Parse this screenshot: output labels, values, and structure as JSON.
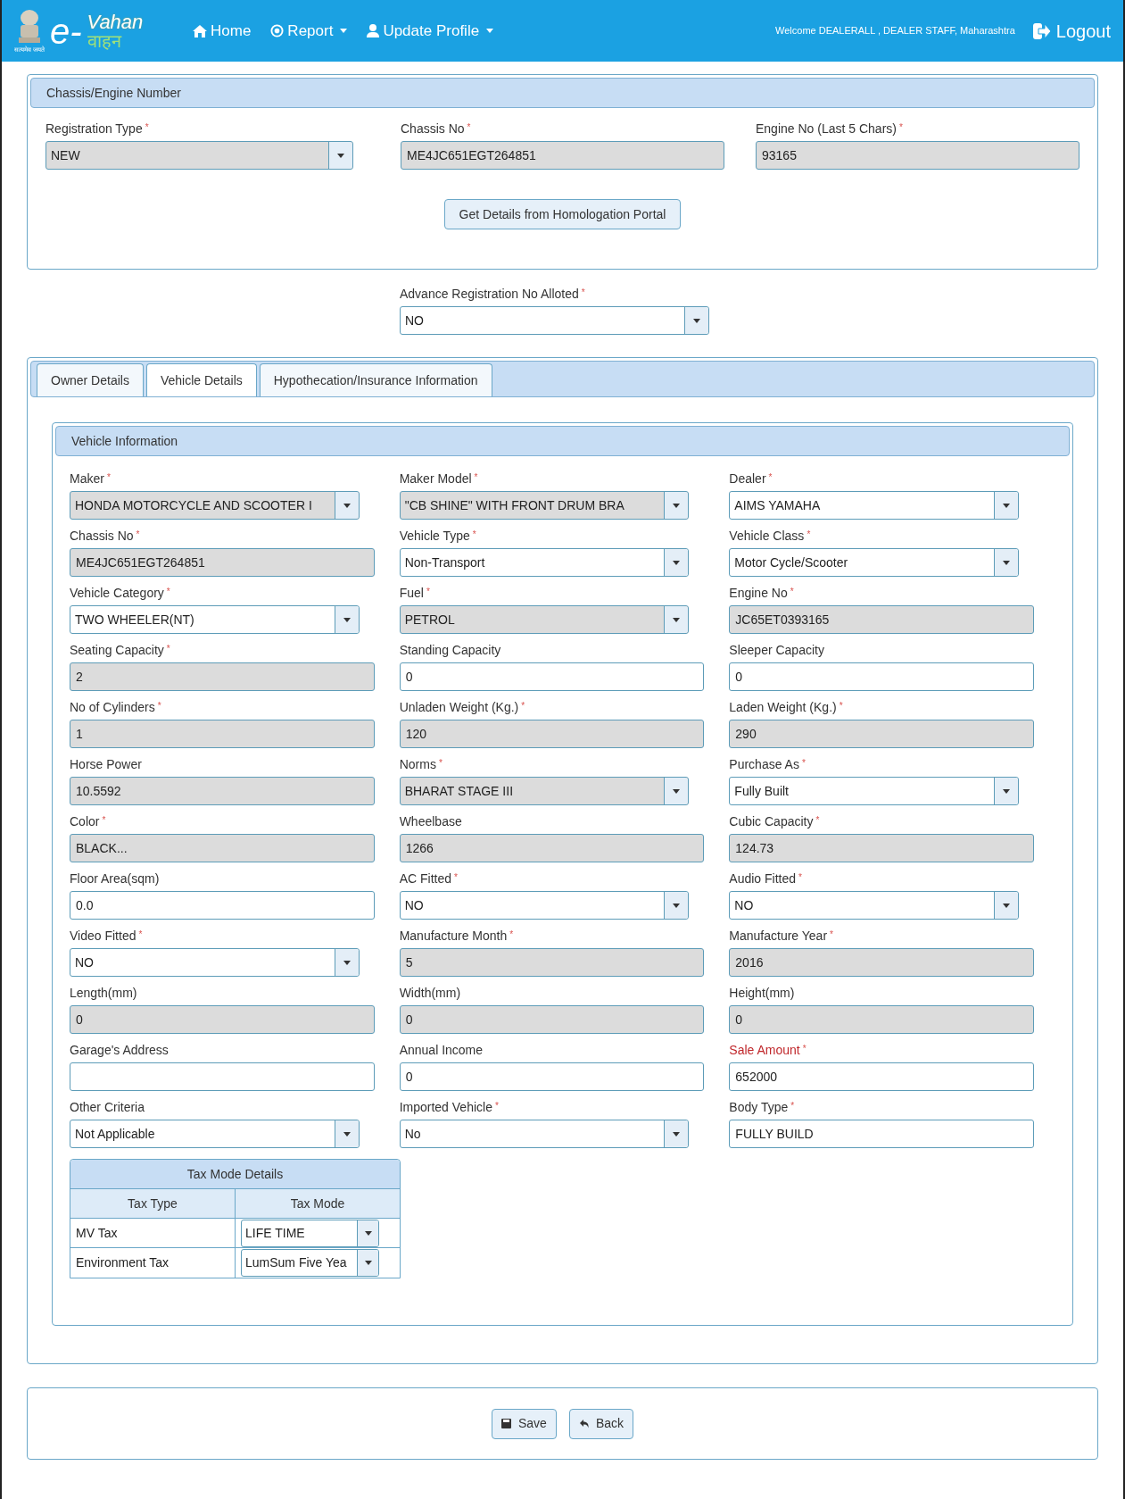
{
  "header": {
    "logo": {
      "prefix": "e-",
      "name": "Vahan",
      "name_hi": "वाहन",
      "motto": "सत्यमेव जयते"
    },
    "nav": [
      {
        "label": "Home",
        "dropdown": false
      },
      {
        "label": "Report",
        "dropdown": true
      },
      {
        "label": "Update Profile",
        "dropdown": true
      }
    ],
    "welcome": "Welcome DEALERALL , DEALER STAFF, Maharashtra",
    "logout": "Logout"
  },
  "chassis_panel": {
    "title": "Chassis/Engine Number",
    "fields": [
      {
        "label": "Registration Type",
        "marker": "*",
        "kind": "select",
        "disabled": true,
        "value": "NEW"
      },
      {
        "label": "Chassis No",
        "marker": "*",
        "kind": "text",
        "disabled": true,
        "value": "ME4JC651EGT264851"
      },
      {
        "label": "Engine No (Last 5 Chars)",
        "marker": "*",
        "kind": "text",
        "disabled": true,
        "value": "93165"
      }
    ],
    "button": "Get Details from Homologation Portal"
  },
  "advance": {
    "label": "Advance Registration No Alloted",
    "marker": "*",
    "kind": "select",
    "disabled": false,
    "value": "NO"
  },
  "tabs": [
    {
      "label": "Owner Details",
      "selected": false
    },
    {
      "label": "Vehicle Details",
      "selected": true
    },
    {
      "label": "Hypothecation/Insurance Information",
      "selected": false
    }
  ],
  "vehicle_info": {
    "title": "Vehicle Information",
    "fields": [
      {
        "label": "Maker",
        "marker": "*",
        "alert": false,
        "kind": "select",
        "disabled": true,
        "value": "HONDA MOTORCYCLE AND SCOOTER I"
      },
      {
        "label": "Maker Model",
        "marker": "*",
        "alert": false,
        "kind": "select",
        "disabled": true,
        "value": "\"CB SHINE\" WITH FRONT DRUM BRA"
      },
      {
        "label": "Dealer",
        "marker": "*",
        "alert": false,
        "kind": "select",
        "disabled": false,
        "value": "AIMS YAMAHA"
      },
      {
        "label": "Chassis No",
        "marker": "*",
        "alert": false,
        "kind": "text",
        "disabled": true,
        "value": "ME4JC651EGT264851"
      },
      {
        "label": "Vehicle Type",
        "marker": "*",
        "alert": false,
        "kind": "select",
        "disabled": false,
        "value": "Non-Transport"
      },
      {
        "label": "Vehicle Class",
        "marker": "*",
        "alert": false,
        "kind": "select",
        "disabled": false,
        "value": "Motor Cycle/Scooter"
      },
      {
        "label": "Vehicle Category",
        "marker": "*",
        "alert": false,
        "kind": "select",
        "disabled": false,
        "value": "TWO WHEELER(NT)"
      },
      {
        "label": "Fuel",
        "marker": "*",
        "alert": false,
        "kind": "select",
        "disabled": true,
        "value": "PETROL"
      },
      {
        "label": "Engine No",
        "marker": "*",
        "alert": false,
        "kind": "text",
        "disabled": true,
        "value": "JC65ET0393165"
      },
      {
        "label": "Seating Capacity",
        "marker": "*",
        "alert": false,
        "kind": "text",
        "disabled": true,
        "value": "2"
      },
      {
        "label": "Standing Capacity",
        "alert": false,
        "kind": "text",
        "disabled": false,
        "value": "0"
      },
      {
        "label": "Sleeper Capacity",
        "alert": false,
        "kind": "text",
        "disabled": false,
        "value": "0"
      },
      {
        "label": "No of Cylinders",
        "marker": "*",
        "alert": false,
        "kind": "text",
        "disabled": true,
        "value": "1"
      },
      {
        "label": "Unladen Weight (Kg.)",
        "marker": "*",
        "alert": false,
        "kind": "text",
        "disabled": true,
        "value": "120"
      },
      {
        "label": "Laden Weight (Kg.)",
        "marker": "*",
        "alert": false,
        "kind": "text",
        "disabled": true,
        "value": "290"
      },
      {
        "label": "Horse Power",
        "alert": false,
        "kind": "text",
        "disabled": true,
        "value": "10.5592"
      },
      {
        "label": "Norms",
        "marker": "*",
        "alert": false,
        "kind": "select",
        "disabled": true,
        "value": "BHARAT STAGE III"
      },
      {
        "label": "Purchase As",
        "marker": "*",
        "alert": false,
        "kind": "select",
        "disabled": false,
        "value": "Fully Built"
      },
      {
        "label": "Color",
        "marker": "*",
        "alert": false,
        "kind": "text",
        "disabled": true,
        "value": "BLACK..."
      },
      {
        "label": "Wheelbase",
        "alert": false,
        "kind": "text",
        "disabled": true,
        "value": "1266"
      },
      {
        "label": "Cubic Capacity",
        "marker": "*",
        "alert": false,
        "kind": "text",
        "disabled": true,
        "value": "124.73"
      },
      {
        "label": "Floor Area(sqm)",
        "alert": false,
        "kind": "text",
        "disabled": false,
        "value": "0.0"
      },
      {
        "label": "AC Fitted",
        "marker": "*",
        "alert": false,
        "kind": "select",
        "disabled": false,
        "value": "NO"
      },
      {
        "label": "Audio Fitted",
        "marker": "*",
        "alert": false,
        "kind": "select",
        "disabled": false,
        "value": "NO"
      },
      {
        "label": "Video Fitted",
        "marker": "*",
        "alert": false,
        "kind": "select",
        "disabled": false,
        "value": "NO"
      },
      {
        "label": "Manufacture Month",
        "marker": "*",
        "alert": false,
        "kind": "text",
        "disabled": true,
        "value": "5"
      },
      {
        "label": "Manufacture Year",
        "marker": "*",
        "alert": false,
        "kind": "text",
        "disabled": true,
        "value": "2016"
      },
      {
        "label": "Length(mm)",
        "alert": false,
        "kind": "text",
        "disabled": true,
        "value": "0"
      },
      {
        "label": "Width(mm)",
        "alert": false,
        "kind": "text",
        "disabled": true,
        "value": "0"
      },
      {
        "label": "Height(mm)",
        "alert": false,
        "kind": "text",
        "disabled": true,
        "value": "0"
      },
      {
        "label": "Garage's Address",
        "alert": false,
        "kind": "text",
        "disabled": false
      },
      {
        "label": "Annual Income",
        "alert": false,
        "kind": "text",
        "disabled": false,
        "value": "0"
      },
      {
        "label": "Sale Amount",
        "marker": "*",
        "alert": true,
        "kind": "text",
        "disabled": false,
        "value": "652000"
      },
      {
        "label": "Other Criteria",
        "alert": false,
        "kind": "select",
        "disabled": false,
        "value": "Not Applicable"
      },
      {
        "label": "Imported Vehicle",
        "marker": "*",
        "alert": false,
        "kind": "select",
        "disabled": false,
        "value": "No"
      },
      {
        "label": "Body Type",
        "marker": "*",
        "alert": false,
        "kind": "text",
        "disabled": false,
        "value": "FULLY BUILD"
      }
    ]
  },
  "tax_table": {
    "title": "Tax Mode Details",
    "columns": [
      "Tax Type",
      "Tax Mode"
    ],
    "rows": [
      {
        "tax_type": "MV Tax",
        "tax_mode": "LIFE TIME"
      },
      {
        "tax_type": "Environment Tax",
        "tax_mode": "LumSum Five Yea"
      }
    ]
  },
  "actions": [
    {
      "label": "Save"
    },
    {
      "label": "Back"
    }
  ]
}
